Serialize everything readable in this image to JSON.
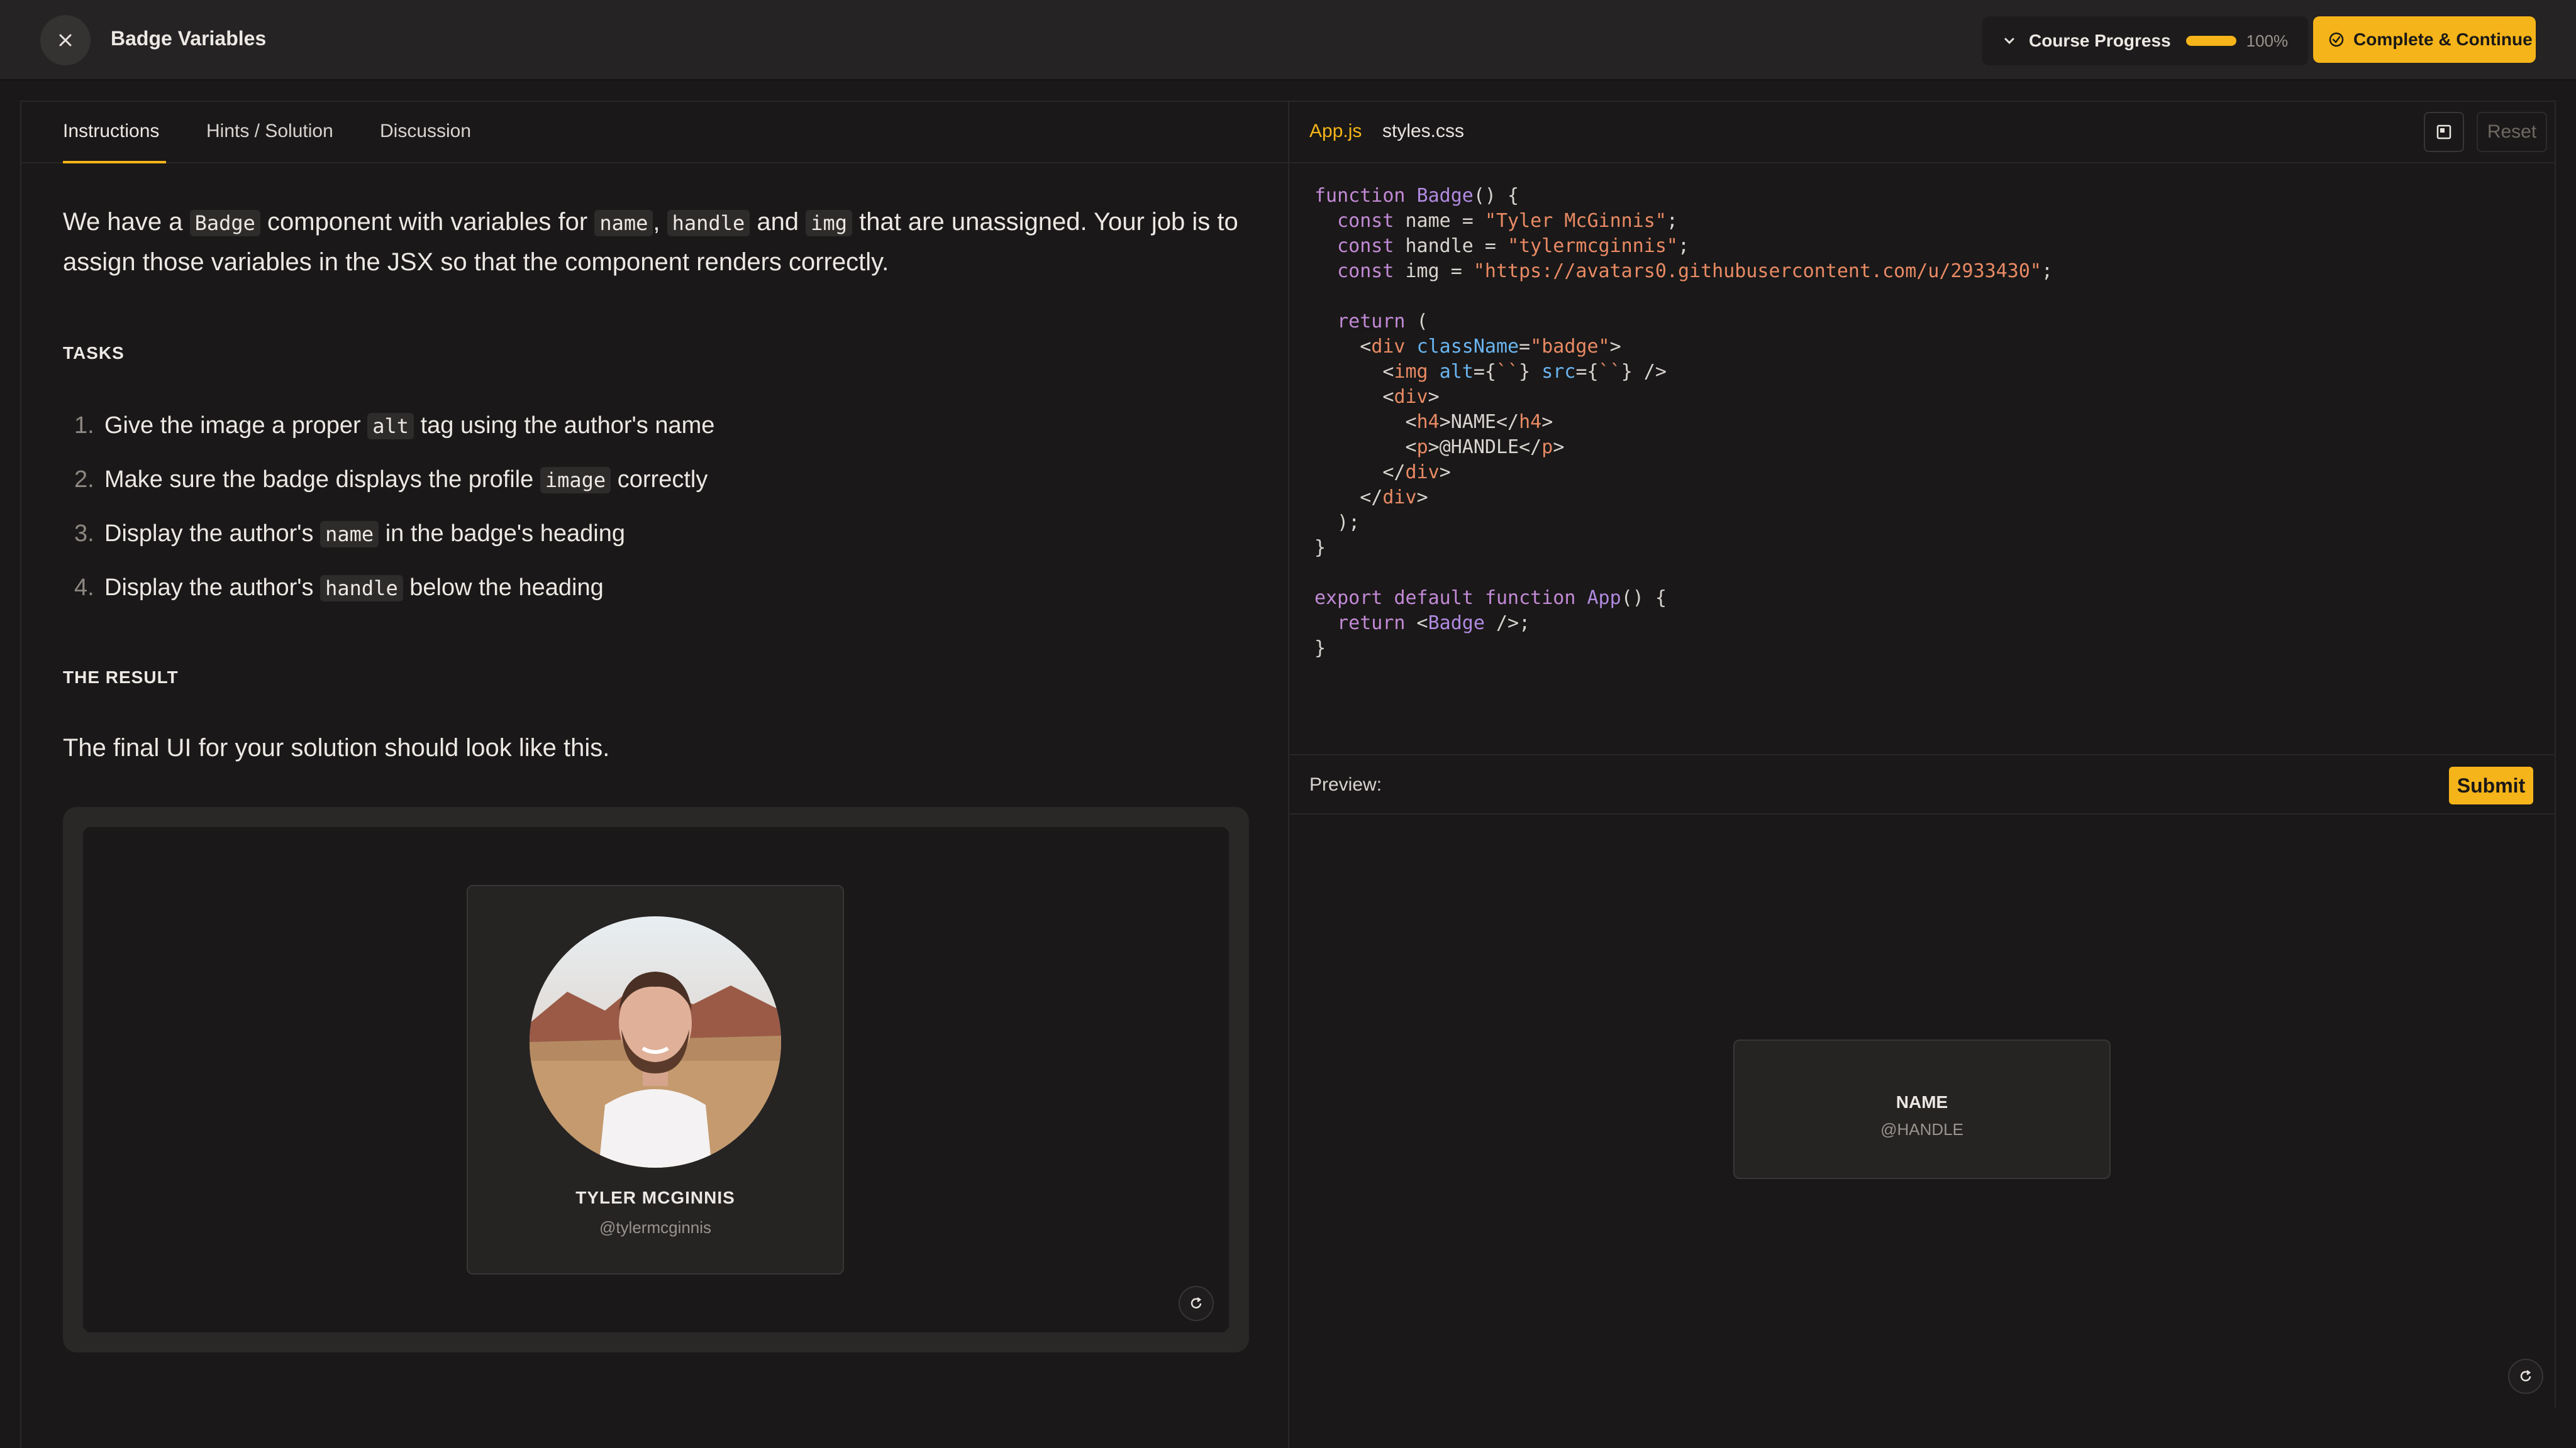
{
  "header": {
    "title": "Badge Variables",
    "progress_label": "Course Progress",
    "progress_value": 1.0,
    "progress_text": "100%",
    "complete_label": "Complete & Continue"
  },
  "tabs": [
    "Instructions",
    "Hints / Solution",
    "Discussion"
  ],
  "instructions": {
    "intro_parts": [
      "We have a ",
      "Badge",
      " component with variables for ",
      "name",
      ", ",
      "handle",
      " and ",
      "img",
      " that are unassigned. Your job is to assign those variables in the JSX so that the component renders correctly."
    ],
    "tasks_heading": "TASKS",
    "tasks": [
      {
        "num": "1.",
        "before": "Give the image a proper ",
        "code": "alt",
        "after": " tag using the author's name"
      },
      {
        "num": "2.",
        "before": "Make sure the badge displays the profile ",
        "code": "image",
        "after": " correctly"
      },
      {
        "num": "3.",
        "before": "Display the author's ",
        "code": "name",
        "after": " in the badge's heading"
      },
      {
        "num": "4.",
        "before": "Display the author's ",
        "code": "handle",
        "after": " below the heading"
      }
    ],
    "result_heading": "THE RESULT",
    "result_text": "The final UI for your solution should look like this.",
    "result_badge": {
      "name": "TYLER MCGINNIS",
      "handle": "@tylermcginnis"
    }
  },
  "editor": {
    "files": [
      "App.js",
      "styles.css"
    ],
    "reset_label": "Reset"
  },
  "preview": {
    "label": "Preview:",
    "submit_label": "Submit",
    "badge_name": "NAME",
    "badge_handle": "@HANDLE"
  },
  "colors": {
    "accent": "#f5b419",
    "background": "#1a1818",
    "panel": "#252323"
  }
}
